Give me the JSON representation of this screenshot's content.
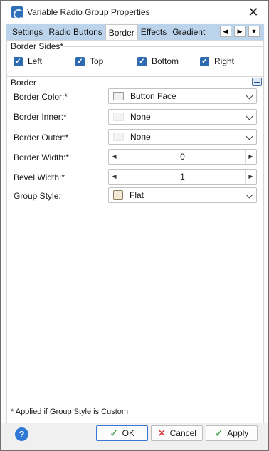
{
  "window": {
    "title": "Variable Radio Group Properties",
    "close_glyph": "✕",
    "icon": "radio-group-app-icon"
  },
  "tabs": [
    "Settings",
    "Radio Buttons",
    "Border",
    "Effects",
    "Gradient"
  ],
  "active_tab": "Border",
  "tab_nav": {
    "prev": "◀",
    "next": "▶",
    "menu": "▼"
  },
  "border_sides": {
    "label": "Border Sides*",
    "items": [
      {
        "label": "Left",
        "checked": true
      },
      {
        "label": "Top",
        "checked": true
      },
      {
        "label": "Bottom",
        "checked": true
      },
      {
        "label": "Right",
        "checked": true
      }
    ],
    "check_glyph": "✓"
  },
  "border": {
    "label": "Border",
    "rows": {
      "color": {
        "label": "Border Color:*",
        "value": "Button Face"
      },
      "inner": {
        "label": "Border Inner:*",
        "value": "None"
      },
      "outer": {
        "label": "Border Outer:*",
        "value": "None"
      },
      "width": {
        "label": "Border Width:*",
        "value": "0"
      },
      "bevel": {
        "label": "Bevel Width:*",
        "value": "1"
      },
      "style": {
        "label": "Group Style:",
        "value": "Flat"
      }
    },
    "spin_left": "◀",
    "spin_right": "▶"
  },
  "footnote": "* Applied if Group Style is Custom",
  "footer": {
    "help": "?",
    "ok": "OK",
    "cancel": "Cancel",
    "apply": "Apply",
    "ok_glyph": "✓",
    "cancel_glyph": "✕",
    "apply_glyph": "✓"
  },
  "colors": {
    "accent": "#2e6ab0",
    "tab_strip": "#bcd3ec",
    "ok_check": "#2e9b3b",
    "cancel_x": "#d63030"
  }
}
